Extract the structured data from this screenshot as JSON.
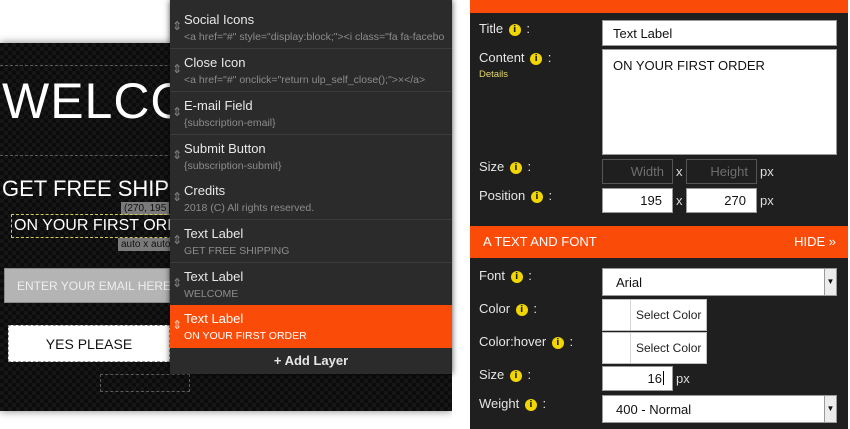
{
  "canvas": {
    "welcome": "WELCO",
    "shipping": "GET FREE SHIP",
    "order": "ON YOUR FIRST ORDE",
    "position_badge": "(270, 195",
    "size_badge": "auto x auto",
    "email_placeholder": "ENTER YOUR EMAIL HERE",
    "submit_label": "YES PLEASE"
  },
  "layers": {
    "items": [
      {
        "title": "Social Icons",
        "subtitle": "<a href=\"#\" style=\"display:block;\"><i class=\"fa fa-facebo",
        "active": false
      },
      {
        "title": "Close Icon",
        "subtitle": "<a href=\"#\" onclick=\"return ulp_self_close();\">×</a>",
        "active": false
      },
      {
        "title": "E-mail Field",
        "subtitle": "{subscription-email}",
        "active": false
      },
      {
        "title": "Submit Button",
        "subtitle": "{subscription-submit}",
        "active": false
      },
      {
        "title": "Credits",
        "subtitle": "2018 (C) All rights reserved.",
        "active": false
      },
      {
        "title": "Text Label",
        "subtitle": "GET FREE SHIPPING",
        "active": false
      },
      {
        "title": "Text Label",
        "subtitle": "WELCOME",
        "active": false
      },
      {
        "title": "Text Label",
        "subtitle": "ON YOUR FIRST ORDER",
        "active": true
      }
    ],
    "handle_icon": "⇕",
    "add_layer_label": "+ Add Layer"
  },
  "properties": {
    "title_label": "Title",
    "title_value": "Text Label",
    "content_label": "Content",
    "details_link": "Details",
    "content_value": "ON YOUR FIRST ORDER",
    "size_label": "Size",
    "width_placeholder": "Width",
    "height_placeholder": "Height",
    "size_sep": "x",
    "size_unit": "px",
    "position_label": "Position",
    "position_left": "195",
    "position_top": "270",
    "position_sep": "x",
    "position_unit": "px",
    "info_glyph": "i",
    "colon": ":"
  },
  "text_font": {
    "section_title": "A TEXT AND FONT",
    "hide_label": "HIDE »",
    "font_label": "Font",
    "font_value": "Arial",
    "color_label": "Color",
    "color_button": "Select Color",
    "hover_label": "Color:hover",
    "hover_button": "Select Color",
    "size_label": "Size",
    "size_value": "16",
    "size_unit": "px",
    "weight_label": "Weight",
    "weight_value": "400 - Normal"
  },
  "colors": {
    "accent": "#fb4b09",
    "panel_bg": "#1f1f1f",
    "layers_bg": "#2b2b2b",
    "info_icon": "#f1d600"
  }
}
